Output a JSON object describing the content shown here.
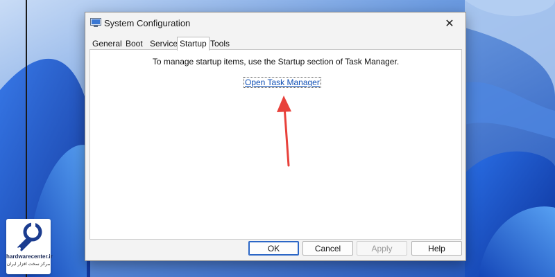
{
  "dialog": {
    "title": "System Configuration",
    "tabs": [
      {
        "label": "General"
      },
      {
        "label": "Boot"
      },
      {
        "label": "Services"
      },
      {
        "label": "Startup"
      },
      {
        "label": "Tools"
      }
    ],
    "active_tab": "Startup",
    "message": "To manage startup items, use the Startup section of Task Manager.",
    "link_label": "Open Task Manager",
    "buttons": {
      "ok": "OK",
      "cancel": "Cancel",
      "apply": "Apply",
      "help": "Help"
    },
    "close_glyph": "✕"
  },
  "watermark": {
    "name": "hardwarecenter.ir",
    "subtitle": "مرکز سخت افزار ایران"
  },
  "colors": {
    "accent": "#2b66c6",
    "link": "#0f4fb5",
    "arrow": "#e8413b",
    "wallpaper": "#3a6fd0"
  },
  "icons": [
    "app-icon",
    "close-icon",
    "arrow-annotation",
    "wrench-logo-icon"
  ]
}
